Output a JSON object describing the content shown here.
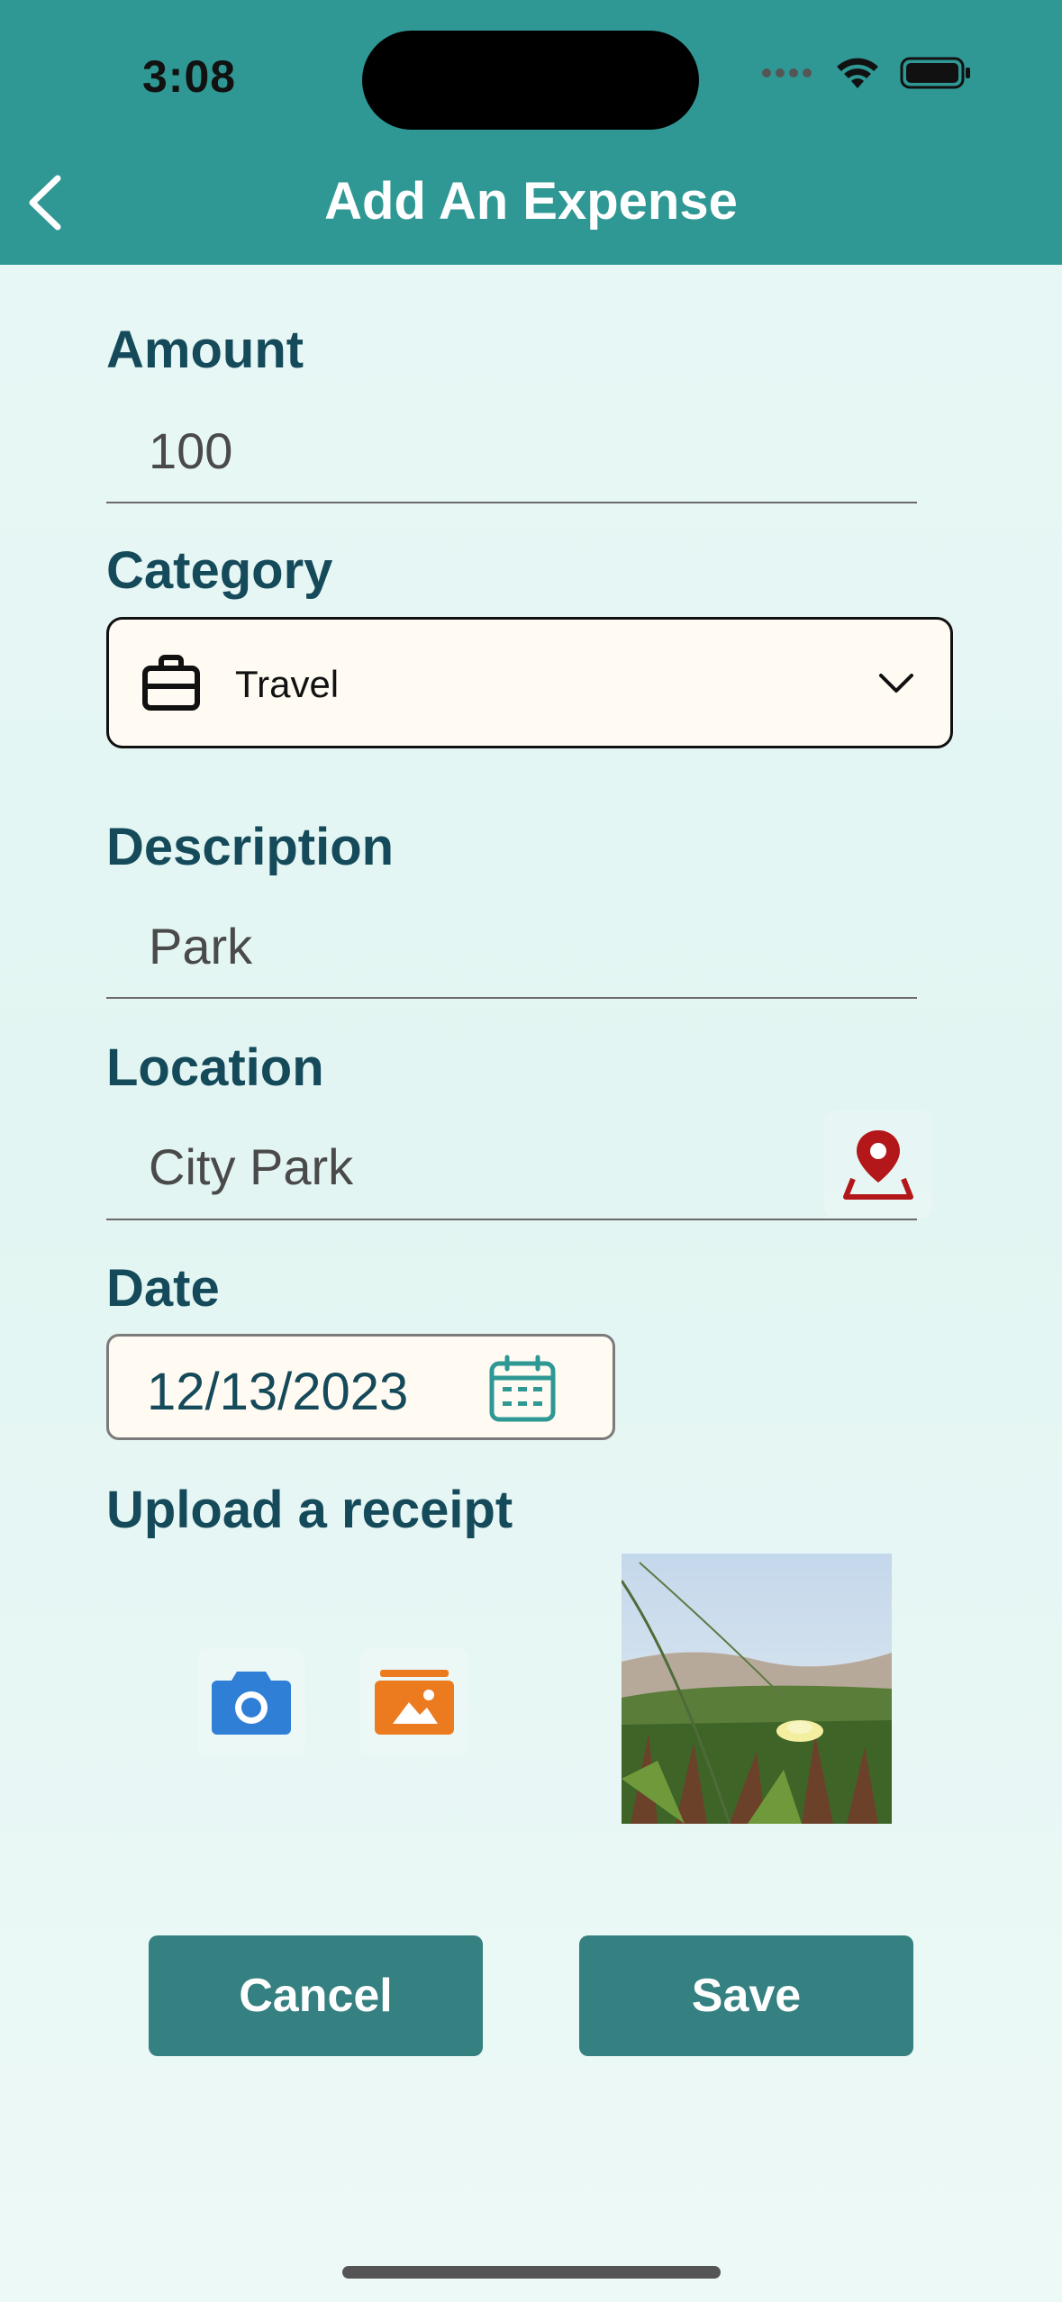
{
  "status_bar": {
    "time": "3:08"
  },
  "header": {
    "title": "Add An Expense"
  },
  "form": {
    "amount": {
      "label": "Amount",
      "value": "100"
    },
    "category": {
      "label": "Category",
      "selected": "Travel",
      "icon": "briefcase-icon"
    },
    "description": {
      "label": "Description",
      "value": "Park"
    },
    "location": {
      "label": "Location",
      "value": "City Park",
      "icon": "map-pin-icon"
    },
    "date": {
      "label": "Date",
      "value": "12/13/2023",
      "icon": "calendar-icon"
    },
    "receipt": {
      "label": "Upload a receipt",
      "camera_icon": "camera-icon",
      "gallery_icon": "gallery-icon"
    }
  },
  "actions": {
    "cancel_label": "Cancel",
    "save_label": "Save"
  },
  "colors": {
    "header_bg": "#2f9894",
    "label": "#154a5a",
    "button_bg": "#358080",
    "pin": "#b3171a",
    "camera": "#2f7fd6",
    "gallery": "#ec7a1e",
    "calendar": "#2f9894"
  }
}
